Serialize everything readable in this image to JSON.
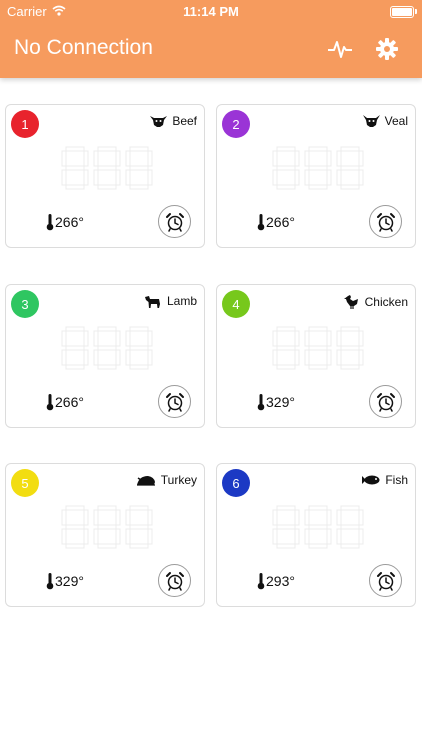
{
  "status_bar": {
    "carrier": "Carrier",
    "time": "11:14 PM"
  },
  "header": {
    "title": "No Connection",
    "color": "#f69b5e"
  },
  "probes": [
    {
      "number": "1",
      "color": "#e8232d",
      "meat": "Beef",
      "icon": "cow-icon",
      "target_temp": "266°",
      "display": "888"
    },
    {
      "number": "2",
      "color": "#9a34d6",
      "meat": "Veal",
      "icon": "calf-icon",
      "target_temp": "266°",
      "display": "888"
    },
    {
      "number": "3",
      "color": "#2fc661",
      "meat": "Lamb",
      "icon": "lamb-icon",
      "target_temp": "266°",
      "display": "888"
    },
    {
      "number": "4",
      "color": "#77c81c",
      "meat": "Chicken",
      "icon": "chicken-icon",
      "target_temp": "329°",
      "display": "888"
    },
    {
      "number": "5",
      "color": "#f2dd11",
      "meat": "Turkey",
      "icon": "turkey-icon",
      "target_temp": "329°",
      "display": "888"
    },
    {
      "number": "6",
      "color": "#1c39c4",
      "meat": "Fish",
      "icon": "fish-icon",
      "target_temp": "293°",
      "display": "888"
    }
  ]
}
